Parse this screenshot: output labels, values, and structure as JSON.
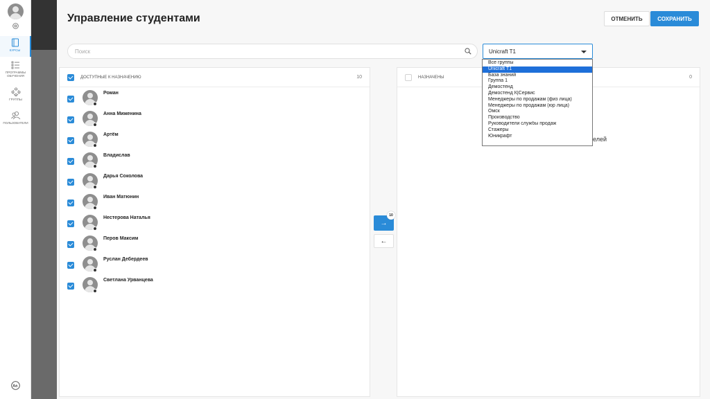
{
  "sidebar": {
    "items": [
      {
        "label": "Курсы",
        "icon": "book-icon",
        "active": true
      },
      {
        "label": "Программы обучения",
        "icon": "list-icon",
        "active": false
      },
      {
        "label": "Группы",
        "icon": "group-icon",
        "active": false
      },
      {
        "label": "Пользователи",
        "icon": "users-icon",
        "active": false
      }
    ],
    "avatar_icon": "user-avatar-icon",
    "settings_icon": "gear-icon",
    "language_icon": "translate-icon"
  },
  "modal": {
    "title": "Управление студентами",
    "cancel_label": "ОТМЕНИТЬ",
    "save_label": "СОХРАНИТЬ"
  },
  "search": {
    "placeholder": "Поиск",
    "value": ""
  },
  "group_select": {
    "value": "Unicraft T1",
    "options": [
      "Все группы",
      "Unicraft T1",
      "База знаний",
      "Группа 1",
      "Демостенд",
      "Демостенд К|Сервис",
      "Менеджеры по продажам (физ лица)",
      "Менеджеры по продажам (юр лица)",
      "Омск",
      "Производство",
      "Руководители службы продаж",
      "Стажеры",
      "Юникрафт"
    ],
    "selected_index": 1
  },
  "available": {
    "label": "ДОСТУПНЫЕ К НАЗНАЧЕНИЮ",
    "count": "10",
    "students": [
      {
        "name": "Роман",
        "checked": true
      },
      {
        "name": "Анна Миженина",
        "checked": true
      },
      {
        "name": "Артём",
        "checked": true
      },
      {
        "name": "Владислав",
        "checked": true
      },
      {
        "name": "Дарья Соколова",
        "checked": true
      },
      {
        "name": "Иван Матюнин",
        "checked": true
      },
      {
        "name": "Нестерова Наталья",
        "checked": true
      },
      {
        "name": "Перов Максим",
        "checked": true
      },
      {
        "name": "Руслан Дебердеев",
        "checked": true
      },
      {
        "name": "Светлана Урванцева",
        "checked": true
      }
    ]
  },
  "assigned": {
    "label": "НАЗНАЧЕНЫ",
    "count": "0",
    "empty_text": "телей"
  },
  "transfer": {
    "right_arrow": "→",
    "left_arrow": "←",
    "badge": "10"
  },
  "colors": {
    "accent": "#2a8bd8",
    "dropdown_selected": "#1e6fd9"
  }
}
